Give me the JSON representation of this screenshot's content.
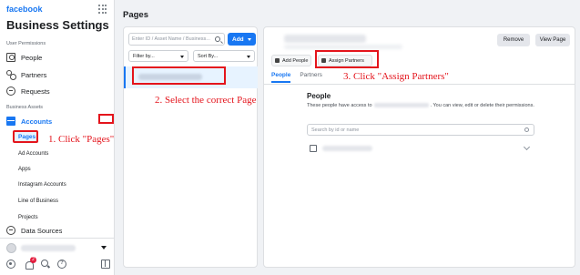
{
  "sidebar": {
    "brand": "facebook",
    "title": "Business Settings",
    "section_user_permissions": "User Permissions",
    "items_user": [
      {
        "label": "People",
        "icon": "people-icon"
      },
      {
        "label": "Partners",
        "icon": "partners-icon"
      },
      {
        "label": "Requests",
        "icon": "requests-icon"
      }
    ],
    "section_business_assets": "Business Assets",
    "accounts_label": "Accounts",
    "sub_items": [
      "Pages",
      "Ad Accounts",
      "Apps",
      "Instagram Accounts",
      "Line of Business",
      "Projects"
    ],
    "data_sources_label": "Data Sources",
    "notification_count": "2"
  },
  "main": {
    "heading": "Pages",
    "search_placeholder": "Enter ID / Asset Name / Business...",
    "add_label": "Add",
    "filter_label": "Filter by...",
    "sort_label": "Sort By..."
  },
  "detail": {
    "remove_label": "Remove",
    "view_page_label": "View Page",
    "add_people_label": "Add People",
    "assign_partners_label": "Assign Partners",
    "tabs": [
      "People",
      "Partners"
    ],
    "people_heading": "People",
    "people_desc_before": "These people have access to",
    "people_desc_after": ". You can view, edit or delete their permissions.",
    "people_search_placeholder": "Search by id or name"
  },
  "annotations": {
    "step1": "1. Click \"Pages\"",
    "step2": "2. Select the correct Page",
    "step3": "3. Click \"Assign Partners\""
  },
  "colors": {
    "accent": "#1877f2",
    "annotation_red": "#e4141c",
    "background": "#f0f2f5"
  }
}
